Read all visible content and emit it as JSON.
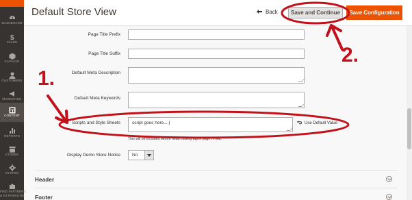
{
  "sidebar": {
    "items": [
      {
        "label": "DASHBOARD",
        "icon": "speedometer-icon"
      },
      {
        "label": "SALES",
        "icon": "dollar-icon"
      },
      {
        "label": "CATALOG",
        "icon": "cube-icon"
      },
      {
        "label": "CUSTOMERS",
        "icon": "person-icon"
      },
      {
        "label": "MARKETING",
        "icon": "megaphone-icon"
      },
      {
        "label": "CONTENT",
        "icon": "layout-icon"
      },
      {
        "label": "REPORTS",
        "icon": "bar-chart-icon"
      },
      {
        "label": "STORES",
        "icon": "store-icon"
      },
      {
        "label": "SYSTEM",
        "icon": "gear-icon"
      },
      {
        "label": "FIND PARTNERS",
        "label2": "& EXTENSIONS",
        "icon": "puzzle-icon"
      }
    ],
    "active": "CONTENT"
  },
  "header": {
    "title": "Default Store View",
    "back_label": "Back",
    "save_continue_label": "Save and Continue",
    "save_config_label": "Save Configuration"
  },
  "form": {
    "page_title_prefix_label": "Page Title Prefix",
    "page_title_suffix_label": "Page Title Suffix",
    "default_meta_description_label": "Default Meta Description",
    "default_meta_keywords_label": "Default Meta Keywords",
    "scripts_label": "Scripts and Style Sheets",
    "scripts_value": "script goes here....|",
    "use_default_label": "Use Default Value",
    "scripts_note": "This will be included before head closing tag in page HTML.",
    "demo_notice_label": "Display Demo Store Notice",
    "demo_notice_value": "No"
  },
  "sections": {
    "header": "Header",
    "footer": "Footer"
  },
  "annotations": {
    "step1": "1.",
    "step2": "2."
  },
  "colors": {
    "sidebar_bg": "#373330",
    "accent": "#eb5202",
    "annotation_red": "#c1121b"
  }
}
